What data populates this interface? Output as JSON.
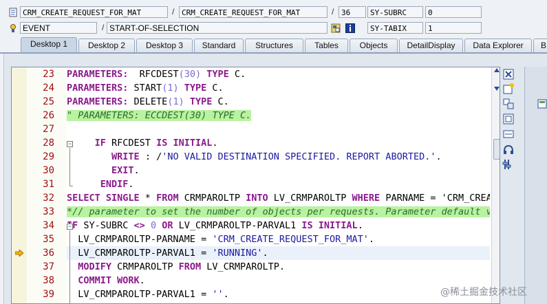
{
  "debug": {
    "program": "CRM_CREATE_REQUEST_FOR_MAT",
    "include": "CRM_CREATE_REQUEST_FOR_MAT",
    "line_no": "36",
    "sy_subrc_label": "SY-SUBRC",
    "sy_subrc_value": "0",
    "event_type": "EVENT",
    "event_name": "START-OF-SELECTION",
    "sy_tabix_label": "SY-TABIX",
    "sy_tabix_value": "1"
  },
  "tabs": [
    "Desktop 1",
    "Desktop 2",
    "Desktop 3",
    "Standard",
    "Structures",
    "Tables",
    "Objects",
    "DetailDisplay",
    "Data Explorer",
    "B"
  ],
  "active_tab": "Desktop 1",
  "lines": [
    {
      "n": "23",
      "p": [
        [
          "kw",
          "PARAMETERS: "
        ],
        [
          "plain",
          " RFCDEST"
        ],
        [
          "num",
          "(30)"
        ],
        [
          "kw",
          " TYPE "
        ],
        [
          "plain",
          "C."
        ]
      ]
    },
    {
      "n": "24",
      "p": [
        [
          "kw",
          "PARAMETERS: "
        ],
        [
          "plain",
          "START"
        ],
        [
          "num",
          "(1)"
        ],
        [
          "kw",
          " TYPE "
        ],
        [
          "plain",
          "C."
        ]
      ]
    },
    {
      "n": "25",
      "p": [
        [
          "kw",
          "PARAMETERS: "
        ],
        [
          "plain",
          "DELETE"
        ],
        [
          "num",
          "(1)"
        ],
        [
          "kw",
          " TYPE "
        ],
        [
          "plain",
          "C."
        ]
      ]
    },
    {
      "n": "26",
      "p": [
        [
          "cmt",
          "\" PARAMETERS: ECCDEST(30) TYPE C."
        ]
      ]
    },
    {
      "n": "27",
      "p": []
    },
    {
      "n": "28",
      "p": [
        [
          "plain",
          "     "
        ],
        [
          "kw",
          "IF "
        ],
        [
          "plain",
          "RFCDEST "
        ],
        [
          "kw",
          "IS INITIAL"
        ],
        [
          "plain",
          "."
        ]
      ]
    },
    {
      "n": "29",
      "p": [
        [
          "plain",
          "        "
        ],
        [
          "kw",
          "WRITE "
        ],
        [
          "plain",
          ": /"
        ],
        [
          "str",
          "'NO VALID DESTINATION SPECIFIED. REPORT ABORTED.'"
        ],
        [
          "plain",
          "."
        ]
      ]
    },
    {
      "n": "30",
      "p": [
        [
          "plain",
          "        "
        ],
        [
          "kw",
          "EXIT"
        ],
        [
          "plain",
          "."
        ]
      ]
    },
    {
      "n": "31",
      "p": [
        [
          "plain",
          "      "
        ],
        [
          "kw",
          "ENDIF"
        ],
        [
          "plain",
          "."
        ]
      ]
    },
    {
      "n": "32",
      "p": [
        [
          "kw",
          "SELECT SINGLE "
        ],
        [
          "plain",
          "* "
        ],
        [
          "kw",
          "FROM "
        ],
        [
          "plain",
          "CRMPAROLTP "
        ],
        [
          "kw",
          "INTO "
        ],
        [
          "plain",
          "LV_CRMPAROLTP "
        ],
        [
          "kw",
          "WHERE "
        ],
        [
          "plain",
          "PARNAME = 'CRM_CREATE_REQUEST_FOR_MAT'."
        ]
      ]
    },
    {
      "n": "33",
      "p": [
        [
          "cmt",
          "*// parameter to set the number of objects per requests. Parameter default value"
        ]
      ]
    },
    {
      "n": "34",
      "p": [
        [
          "kw",
          "IF "
        ],
        [
          "plain",
          "SY-SUBRC "
        ],
        [
          "kw",
          "<> "
        ],
        [
          "num",
          "0 "
        ],
        [
          "kw",
          "OR "
        ],
        [
          "plain",
          "LV_CRMPAROLTP-PARVAL1 "
        ],
        [
          "kw",
          "IS INITIAL"
        ],
        [
          "plain",
          "."
        ]
      ]
    },
    {
      "n": "35",
      "p": [
        [
          "plain",
          "  LV_CRMPAROLTP-PARNAME = "
        ],
        [
          "str",
          "'CRM_CREATE_REQUEST_FOR_MAT'"
        ],
        [
          "plain",
          "."
        ]
      ]
    },
    {
      "n": "36",
      "p": [
        [
          "plain",
          "  LV_CRMPAROLTP-PARVAL1 = "
        ],
        [
          "str",
          "'RUNNING'"
        ],
        [
          "plain",
          "."
        ]
      ]
    },
    {
      "n": "37",
      "p": [
        [
          "plain",
          "  "
        ],
        [
          "kw",
          "MODIFY "
        ],
        [
          "plain",
          "CRMPAROLTP "
        ],
        [
          "kw",
          "FROM "
        ],
        [
          "plain",
          "LV_CRMPAROLTP."
        ]
      ]
    },
    {
      "n": "38",
      "p": [
        [
          "plain",
          "  "
        ],
        [
          "kw",
          "COMMIT WORK"
        ],
        [
          "plain",
          "."
        ]
      ]
    },
    {
      "n": "39",
      "p": [
        [
          "plain",
          "  LV_CRMPAROLTP-PARVAL1 = "
        ],
        [
          "str",
          "''"
        ],
        [
          "plain",
          "."
        ]
      ]
    }
  ],
  "current_line": "36",
  "watermark": "@稀土掘金技术社区"
}
